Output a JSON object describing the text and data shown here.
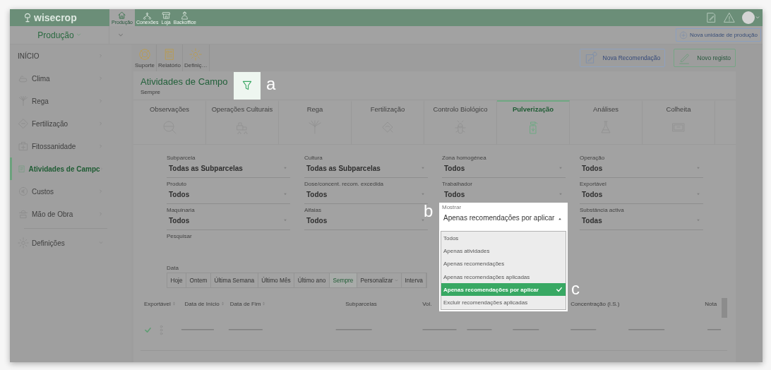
{
  "top_bar": {
    "logo": "wisecrop",
    "apps": [
      {
        "label": "Produção",
        "selected": true
      },
      {
        "label": "Conexões",
        "selected": false
      },
      {
        "label": "Loja",
        "selected": false
      },
      {
        "label": "Backoffice",
        "selected": false
      }
    ]
  },
  "unit_selector": "Produção",
  "new_unit_button": "Nova unidade de produção",
  "sidebar": {
    "items": [
      {
        "label": "INÍCIO",
        "kind": "link",
        "selected": false
      },
      {
        "label": "Clima",
        "kind": "link",
        "selected": false
      },
      {
        "label": "Rega",
        "kind": "link",
        "selected": false
      },
      {
        "label": "Fertilização",
        "kind": "link",
        "selected": false
      },
      {
        "label": "Fitossanidade",
        "kind": "link",
        "selected": false
      },
      {
        "label": "Atividades de Campc",
        "kind": "link",
        "selected": true
      },
      {
        "label": "Custos",
        "kind": "link",
        "selected": false
      },
      {
        "label": "Mão de Obra",
        "kind": "link",
        "selected": false
      },
      {
        "label": "Definições",
        "kind": "group",
        "selected": false
      }
    ]
  },
  "toolbar": [
    {
      "label": "Suporte"
    },
    {
      "label": "Relatório"
    },
    {
      "label": "Definiç…"
    }
  ],
  "actions": [
    "Nova Recomendação",
    "Novo registo"
  ],
  "page": {
    "title": "Atividades de Campo",
    "subtitle": "Sempre"
  },
  "annotations": [
    "a",
    "b",
    "c"
  ],
  "tabs": [
    {
      "label": "Observações",
      "selected": false
    },
    {
      "label": "Operações Culturais",
      "selected": false
    },
    {
      "label": "Rega",
      "selected": false
    },
    {
      "label": "Fertilização",
      "selected": false
    },
    {
      "label": "Controlo Biológico",
      "selected": false
    },
    {
      "label": "Pulverização",
      "selected": true
    },
    {
      "label": "Análises",
      "selected": false
    },
    {
      "label": "Colheita",
      "selected": false
    }
  ],
  "filters": [
    {
      "kind": "select",
      "label": "Subparcela",
      "value": "Todas as Subparcelas",
      "open": false
    },
    {
      "kind": "select",
      "label": "Cultura",
      "value": "Todas as Subparcelas",
      "open": false
    },
    {
      "kind": "select",
      "label": "Zona homogénea",
      "value": "Todos",
      "open": false
    },
    {
      "kind": "select",
      "label": "Operação",
      "value": "Todos",
      "open": false
    },
    {
      "kind": "select",
      "label": "Produto",
      "value": "Todos",
      "open": false
    },
    {
      "kind": "select",
      "label": "Dose/concent. recom. excedida",
      "value": "Todos",
      "open": false
    },
    {
      "kind": "select",
      "label": "Trabalhador",
      "value": "Todos",
      "open": false
    },
    {
      "kind": "select",
      "label": "Exportável",
      "value": "Todos",
      "open": false
    },
    {
      "kind": "select",
      "label": "Maquinaria",
      "value": "Todos",
      "open": false
    },
    {
      "kind": "select",
      "label": "Alfaias",
      "value": "Todos",
      "open": false
    },
    {
      "kind": "select",
      "label": "Mostrar",
      "value": "Apenas recomendações por aplicar",
      "open": true,
      "options": [
        {
          "label": "Todos",
          "selected": false
        },
        {
          "label": "Apenas atividades",
          "selected": false
        },
        {
          "label": "Apenas recomendações",
          "selected": false
        },
        {
          "label": "Apenas recomendações aplicadas",
          "selected": false
        },
        {
          "label": "Apenas recomendações por aplicar",
          "selected": true
        },
        {
          "label": "Excluir recomendações aplicadas",
          "selected": false
        }
      ]
    },
    {
      "kind": "select",
      "label": "Substância activa",
      "value": "Todas",
      "open": false
    },
    {
      "kind": "search",
      "label": "Pesquisar"
    }
  ],
  "date": {
    "label": "Data",
    "ranges": [
      {
        "label": "Hoje",
        "kind": "button",
        "selected": false
      },
      {
        "label": "Ontem",
        "kind": "button",
        "selected": false
      },
      {
        "label": "Última Semana",
        "kind": "button",
        "selected": false
      },
      {
        "label": "Último Mês",
        "kind": "button",
        "selected": false
      },
      {
        "label": "Último ano",
        "kind": "button",
        "selected": false
      },
      {
        "label": "Sempre",
        "kind": "button",
        "selected": true
      },
      {
        "label": "Personalizar",
        "kind": "menu",
        "selected": false
      },
      {
        "label": "Interva",
        "kind": "button",
        "selected": false
      }
    ]
  },
  "table": {
    "columns": [
      {
        "label": "Exportável",
        "sortable": true
      },
      {
        "label": "Data de Início",
        "sortable": true
      },
      {
        "label": "Data de Fim",
        "sortable": true
      },
      {
        "label": "Subparcelas",
        "sortable": false
      },
      {
        "label": "Vol.",
        "sortable": false
      },
      {
        "label": "Concentração (I.S.)",
        "sortable": false
      },
      {
        "label": "Nota",
        "sortable": false
      }
    ],
    "rows": [
      {
        "exportable": true
      }
    ]
  }
}
